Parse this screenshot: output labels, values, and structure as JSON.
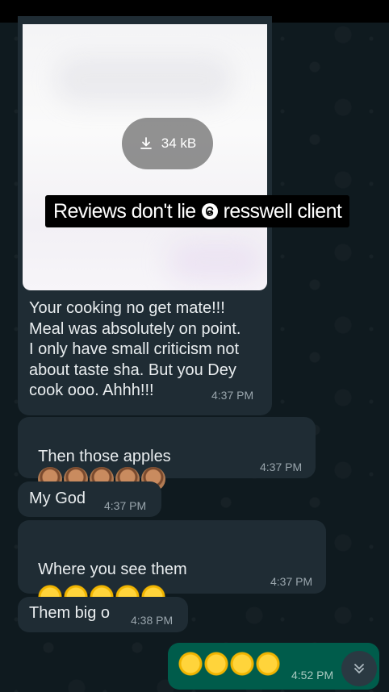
{
  "media": {
    "download_size": "34 kB",
    "caption": "Reviews don't lie",
    "caption_handle": "resswell client"
  },
  "messages": [
    {
      "text": "Your cooking no get mate!!!\nMeal was absolutely on point.\nI only have small criticism not\nabout taste sha. But you Dey\ncook ooo. Ahhh!!!",
      "time": "4:37 PM",
      "direction": "in"
    },
    {
      "text": "Then those apples",
      "emojis": [
        "woman-gesturing-ok",
        "woman-gesturing-ok",
        "woman-gesturing-ok",
        "woman-gesturing-ok",
        "woman-gesturing-ok"
      ],
      "time": "4:37 PM",
      "direction": "in"
    },
    {
      "text": "My God",
      "time": "4:37 PM",
      "direction": "in"
    },
    {
      "text": "Where you see them",
      "emojis": [
        "rolling-on-floor-laughing",
        "rolling-on-floor-laughing",
        "rolling-on-floor-laughing",
        "rolling-on-floor-laughing",
        "rolling-on-floor-laughing"
      ],
      "time": "4:37 PM",
      "direction": "in"
    },
    {
      "text": "Them big o",
      "time": "4:38 PM",
      "direction": "in"
    },
    {
      "text": "",
      "emojis": [
        "face-with-tears-of-joy",
        "face-with-tears-of-joy",
        "face-with-tears-of-joy",
        "face-with-tears-of-joy"
      ],
      "time": "4:52 PM",
      "direction": "out"
    }
  ],
  "icons": {
    "download": "download-icon",
    "scroll": "double-chevron-down-icon",
    "threads": "threads-icon"
  },
  "colors": {
    "incoming_bubble": "#1f2c34",
    "outgoing_bubble": "#005c4b",
    "timestamp": "#9aa6ad"
  }
}
